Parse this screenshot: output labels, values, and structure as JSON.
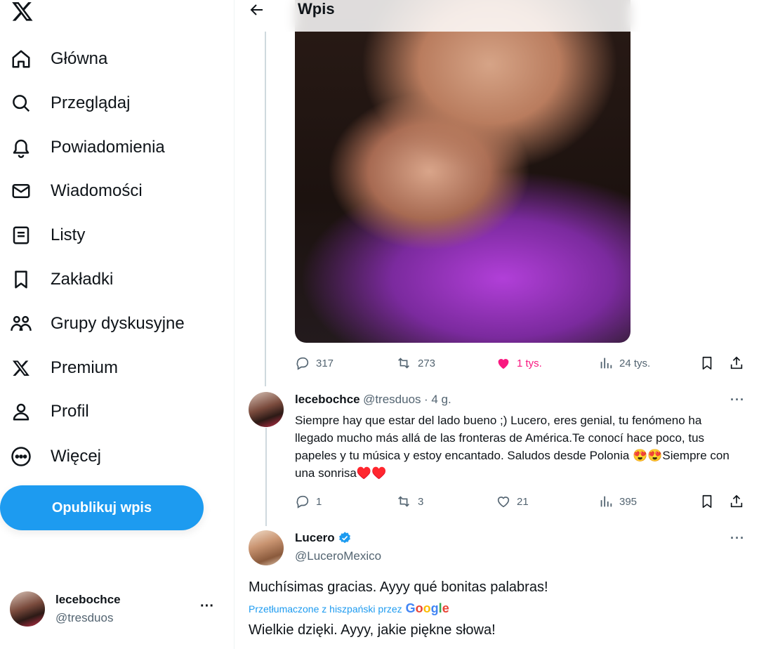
{
  "app": {
    "logo": "x-logo"
  },
  "sidebar": {
    "items": [
      {
        "label": "Główna",
        "icon": "home-icon"
      },
      {
        "label": "Przeglądaj",
        "icon": "search-icon"
      },
      {
        "label": "Powiadomienia",
        "icon": "bell-icon"
      },
      {
        "label": "Wiadomości",
        "icon": "mail-icon"
      },
      {
        "label": "Listy",
        "icon": "list-icon"
      },
      {
        "label": "Zakładki",
        "icon": "bookmark-icon"
      },
      {
        "label": "Grupy dyskusyjne",
        "icon": "people-icon"
      },
      {
        "label": "Premium",
        "icon": "x-logo-icon"
      },
      {
        "label": "Profil",
        "icon": "person-icon"
      },
      {
        "label": "Więcej",
        "icon": "more-circle-icon"
      }
    ],
    "post_button": "Opublikuj wpis",
    "account": {
      "name": "lecebochce",
      "handle": "@tresduos",
      "more": "···"
    }
  },
  "header": {
    "title": "Wpis"
  },
  "post": {
    "replies": "317",
    "reposts": "273",
    "likes": "1 tys.",
    "views": "24 tys.",
    "liked": true,
    "accent_like": "#f91880"
  },
  "reply1": {
    "name": "lecebochce",
    "handle": "@tresduos",
    "time": "· 4 g.",
    "text": "Siempre hay que estar del lado bueno ;) Lucero, eres genial, tu fenómeno ha llegado mucho más allá de las fronteras de América.Te conocí hace poco, tus papeles y tu música y estoy encantado. Saludos desde Polonia 😍😍Siempre con una sonrisa♥️♥️",
    "replies": "1",
    "reposts": "3",
    "likes": "21",
    "views": "395"
  },
  "reply2": {
    "name": "Lucero",
    "handle": "@LuceroMexico",
    "verified": true,
    "text": "Muchísimas gracias. Ayyy qué bonitas palabras!",
    "translated_by": "Przetłumaczone z hiszpański przez",
    "translator": "Google",
    "translation": "Wielkie dzięki. Ayyy, jakie piękne słowa!"
  },
  "colors": {
    "accent": "#1d9bf0",
    "text": "#0f1419",
    "secondary": "#536471",
    "like": "#f91880"
  }
}
